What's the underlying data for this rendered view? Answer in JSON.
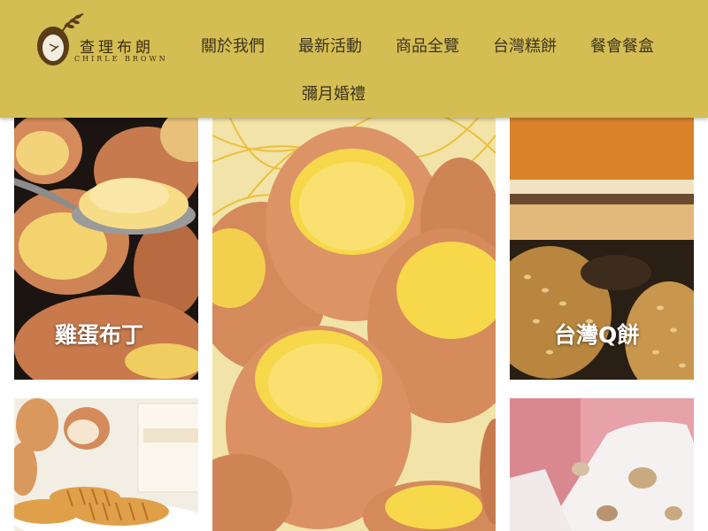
{
  "brand": {
    "name": "查理布朗",
    "tagline": "CHIRLE BROWN",
    "header_color": "#d4bd52"
  },
  "nav": {
    "items": [
      {
        "label": "關於我們"
      },
      {
        "label": "最新活動"
      },
      {
        "label": "商品全覽"
      },
      {
        "label": "台灣糕餅"
      },
      {
        "label": "餐會餐盒"
      },
      {
        "label": "彌月婚禮"
      }
    ]
  },
  "products": [
    {
      "label": "雞蛋布丁",
      "image": "egg-pudding-photo"
    },
    {
      "label": "",
      "image": "egg-pudding-shells-photo"
    },
    {
      "label": "台灣Q餅",
      "image": "taiwan-q-cake-photo"
    },
    {
      "label": "",
      "image": "egg-rolls-gift-box-photo"
    },
    {
      "label": "",
      "image": "nougat-photo"
    }
  ]
}
